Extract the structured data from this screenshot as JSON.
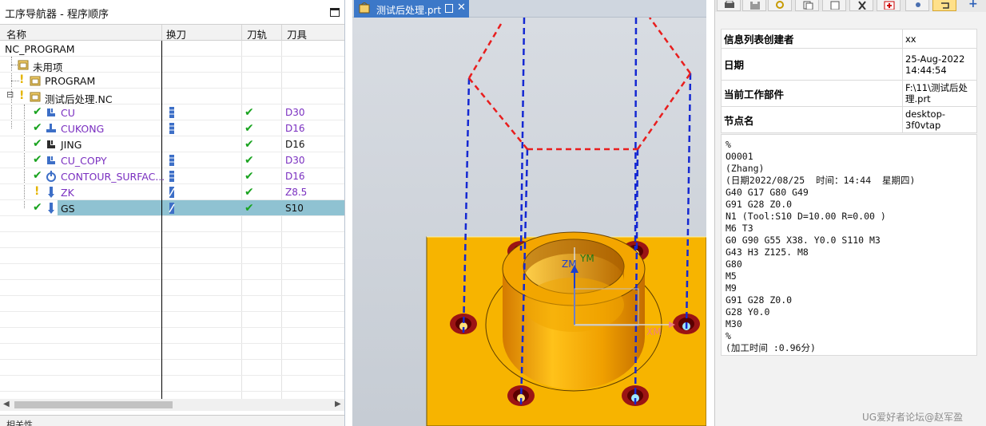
{
  "navigator": {
    "title": "工序导航器 - 程序顺序",
    "columns": {
      "name": "名称",
      "tool_change": "换刀",
      "path": "刀轨",
      "tool": "刀具"
    },
    "rows": [
      {
        "name": "NC_PROGRAM",
        "tool": ""
      },
      {
        "name": "未用项",
        "tool": ""
      },
      {
        "name": "PROGRAM",
        "tool": ""
      },
      {
        "name": "测试后处理.NC",
        "tool": ""
      },
      {
        "name": "CU",
        "tool": "D30"
      },
      {
        "name": "CUKONG",
        "tool": "D16"
      },
      {
        "name": "JING",
        "tool": "D16"
      },
      {
        "name": "CU_COPY",
        "tool": "D30"
      },
      {
        "name": "CONTOUR_SURFAC...",
        "tool": "D16"
      },
      {
        "name": "ZK",
        "tool": "Z8.5"
      },
      {
        "name": "GS",
        "tool": "S10"
      }
    ],
    "bottom_panel_label": "相关性"
  },
  "graphics": {
    "tab_label": "测试后处理.prt",
    "axis_labels": {
      "y": "YM",
      "z": "ZM",
      "x": "XM"
    }
  },
  "info": {
    "rows": [
      {
        "key": "信息列表创建者",
        "value": "xx"
      },
      {
        "key": "日期",
        "value": "25-Aug-2022\n14:44:54"
      },
      {
        "key": "当前工作部件",
        "value": "F:\\11\\测试后处\n理.prt"
      },
      {
        "key": "节点名",
        "value": "desktop-3f0vtap"
      }
    ],
    "nc_code": "%\nO0001\n(Zhang)\n(日期2022/08/25  时间：14:44  星期四)\nG40 G17 G80 G49\nG91 G28 Z0.0\nN1 (Tool:S10 D=10.00 R=0.00 )\nM6 T3\nG0 G90 G55 X38. Y0.0 S110 M3\nG43 H3 Z125. M8\nG80\nM5\nM9\nG91 G28 Z0.0\nG28 Y0.0\nM30\n%\n(加工时间 :0.96分)"
  },
  "watermark": "UG爱好者论坛@赵军盈",
  "colors": {
    "selection": "#8fc2d2",
    "part_body": "#f7b400",
    "toolpath_blue": "#1428d2",
    "toolpath_red": "#e81e1e",
    "active_tab": "#3c78c8",
    "check_green": "#19a31f",
    "op_name_purple": "#7a2fc0"
  }
}
